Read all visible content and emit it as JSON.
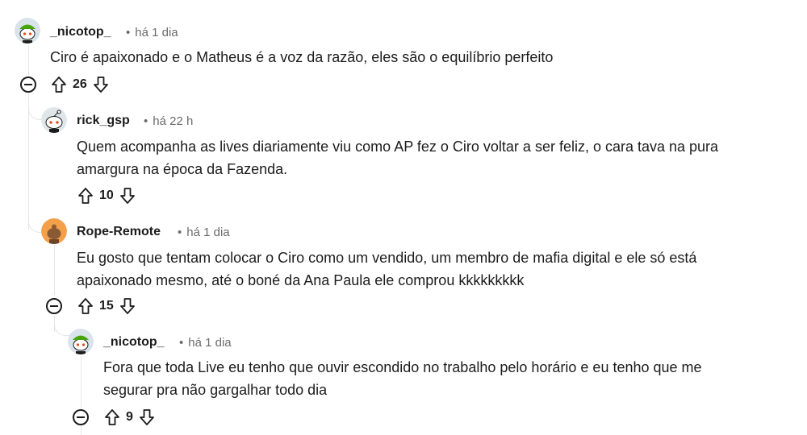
{
  "comments": [
    {
      "author": "_nicotop_",
      "time": "há 1 dia",
      "text": "Ciro é apaixonado e o Matheus é a voz da razão, eles são o equilíbrio perfeito",
      "votes": "26",
      "avatar": "snoo-green-cap-icon"
    },
    {
      "author": "rick_gsp",
      "time": "há 22 h",
      "text_lines": [
        "Quem acompanha as lives diariamente viu como AP fez o Ciro voltar a ser feliz, o cara tava na pura",
        "amargura na época da Fazenda."
      ],
      "votes": "10",
      "avatar": "snoo-default-icon"
    },
    {
      "author": "Rope-Remote",
      "time": "há 1 dia",
      "text_lines": [
        "Eu gosto que tentam colocar o Ciro como um vendido, um membro de mafia digital e ele só está",
        "apaixonado mesmo, até o boné da Ana Paula ele comprou kkkkkkkkk"
      ],
      "votes": "15",
      "avatar": "snoo-orange-icon"
    },
    {
      "author": "_nicotop_",
      "time": "há 1 dia",
      "text_lines": [
        "Fora que toda Live eu tenho que ouvir escondido no trabalho pelo horário e eu tenho que me",
        "segurar pra não gargalhar todo dia"
      ],
      "votes": "9",
      "avatar": "snoo-green-cap-icon"
    }
  ],
  "meta_separator": "•"
}
